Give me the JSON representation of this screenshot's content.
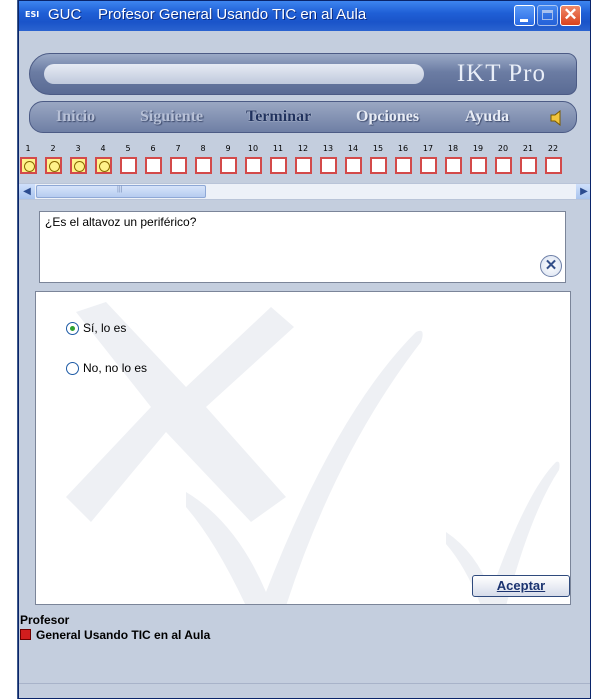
{
  "window": {
    "app_icon": "ESI",
    "title": "GUC    Profesor General Usando TIC en al Aula",
    "controls": [
      "minimize-icon",
      "maximize-icon",
      "close-icon"
    ]
  },
  "header": {
    "brand": "IKT Pro"
  },
  "menu": {
    "items": [
      {
        "label": "Inicio",
        "state": "disabled"
      },
      {
        "label": "Siguiente",
        "state": "disabled"
      },
      {
        "label": "Terminar",
        "state": "active"
      },
      {
        "label": "Opciones",
        "state": "enabled"
      },
      {
        "label": "Ayuda",
        "state": "enabled"
      }
    ],
    "speaker_icon": "speaker-icon"
  },
  "progress": {
    "numbers": [
      "1",
      "2",
      "3",
      "4",
      "5",
      "6",
      "7",
      "8",
      "9",
      "10",
      "11",
      "12",
      "13",
      "14",
      "15",
      "16",
      "17",
      "18",
      "19",
      "20",
      "21",
      "22"
    ],
    "answered": [
      1,
      2,
      3,
      4
    ]
  },
  "question": {
    "text": "¿Es el altavoz un periférico?",
    "close_icon": "close-circle-icon"
  },
  "answers": {
    "options": [
      {
        "label": "Sí, lo es",
        "checked": true
      },
      {
        "label": "No, no lo es",
        "checked": false
      }
    ],
    "accept_label": "Aceptar"
  },
  "status": {
    "role": "Profesor",
    "name": "General Usando TIC en al Aula"
  }
}
